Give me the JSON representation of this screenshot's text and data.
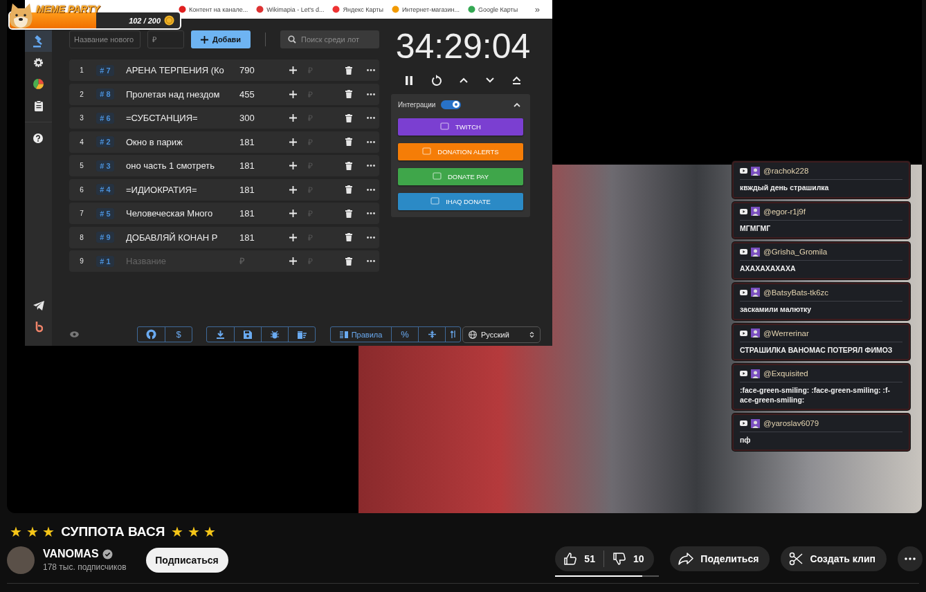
{
  "meme_widget": {
    "title": "MEME PARTY",
    "count": "102 / 200",
    "level": 0.51
  },
  "bookmarks": [
    {
      "label": "Контент на канале..."
    },
    {
      "label": "Wikimapia - Let's d..."
    },
    {
      "label": "Яндекс Карты"
    },
    {
      "label": "Интернет-магазин..."
    },
    {
      "label": "Google Карты"
    }
  ],
  "bookmarks_more": "»",
  "app": {
    "sidebar": [
      {
        "kind": "gavel",
        "selected": true
      },
      {
        "kind": "gear",
        "selected": false
      },
      {
        "kind": "chart",
        "selected": false
      },
      {
        "kind": "clipboard",
        "selected": false
      },
      {
        "kind": "help",
        "selected": false
      }
    ],
    "new_lot": {
      "name_placeholder": "Название нового",
      "amount_placeholder": "₽",
      "add_label": "Добави",
      "search_placeholder": "Поиск среди лот"
    },
    "lots": [
      {
        "index": "1",
        "tag": "# 7",
        "name": "АРЕНА ТЕРПЕНИЯ (Ко",
        "amount": "790",
        "unit": "₽"
      },
      {
        "index": "2",
        "tag": "# 8",
        "name": "Пролетая над гнездом",
        "amount": "455",
        "unit": "₽"
      },
      {
        "index": "3",
        "tag": "# 6",
        "name": "=СУБСТАНЦИЯ=",
        "amount": "300",
        "unit": "₽"
      },
      {
        "index": "4",
        "tag": "# 2",
        "name": "Окно в париж",
        "amount": "181",
        "unit": "₽"
      },
      {
        "index": "5",
        "tag": "# 3",
        "name": "оно часть 1 смотреть",
        "amount": "181",
        "unit": "₽"
      },
      {
        "index": "6",
        "tag": "# 4",
        "name": "=ИДИОКРАТИЯ=",
        "amount": "181",
        "unit": "₽"
      },
      {
        "index": "7",
        "tag": "# 5",
        "name": "Человеческая Много",
        "amount": "181",
        "unit": "₽"
      },
      {
        "index": "8",
        "tag": "# 9",
        "name": "ДОБАВЛЯЙ КОНАН Р",
        "amount": "181",
        "unit": "₽"
      },
      {
        "index": "9",
        "tag": "# 1",
        "name_placeholder": "Название",
        "amount_placeholder": "₽",
        "unit": "₽"
      }
    ],
    "timer": "34:29:04",
    "integrations": {
      "label": "Интеграции",
      "enabled": true,
      "services": [
        {
          "label": "TWITCH",
          "color": "#7b3fd1"
        },
        {
          "label": "DONATION ALERTS",
          "color": "#f57d07"
        },
        {
          "label": "DONATE PAY",
          "color": "#3fa64a"
        },
        {
          "label": "IHAQ DONATE",
          "color": "#2b8ac6"
        }
      ]
    },
    "footer": {
      "donate": "$",
      "rules": "Правила",
      "percent": "%",
      "language": "Русский"
    }
  },
  "chat": [
    {
      "user": "@rachok228",
      "text": "квждый день страшилка"
    },
    {
      "user": "@egor-r1j9f",
      "text": "МГМГМГ"
    },
    {
      "user": "@Grisha_Gromila",
      "text": "АХАХАХАХАХА"
    },
    {
      "user": "@BatsyBats-tk6zc",
      "text": "заскамили малютку"
    },
    {
      "user": "@Werrerinar",
      "text": "СТРАШИЛКА ВАНОМАС ПОТЕРЯЛ ФИМОЗ"
    },
    {
      "user": "@Exquisited",
      "text": ":face-green-smiling: :face-green-smiling: :f-ace-green-smiling:"
    },
    {
      "user": "@yaroslav6079",
      "text": "пф"
    }
  ],
  "video": {
    "title_prefix": "★ ★ ★",
    "title": "СУППОТА ВАСЯ",
    "title_suffix": "★ ★ ★",
    "channel": "VANOMAS",
    "subscribers": "178 тыс. подписчиков",
    "subscribe": "Подписаться",
    "likes": "51",
    "dislikes": "10",
    "like_ratio": {
      "level": 0.84
    },
    "share": "Поделиться",
    "clip": "Создать клип"
  }
}
